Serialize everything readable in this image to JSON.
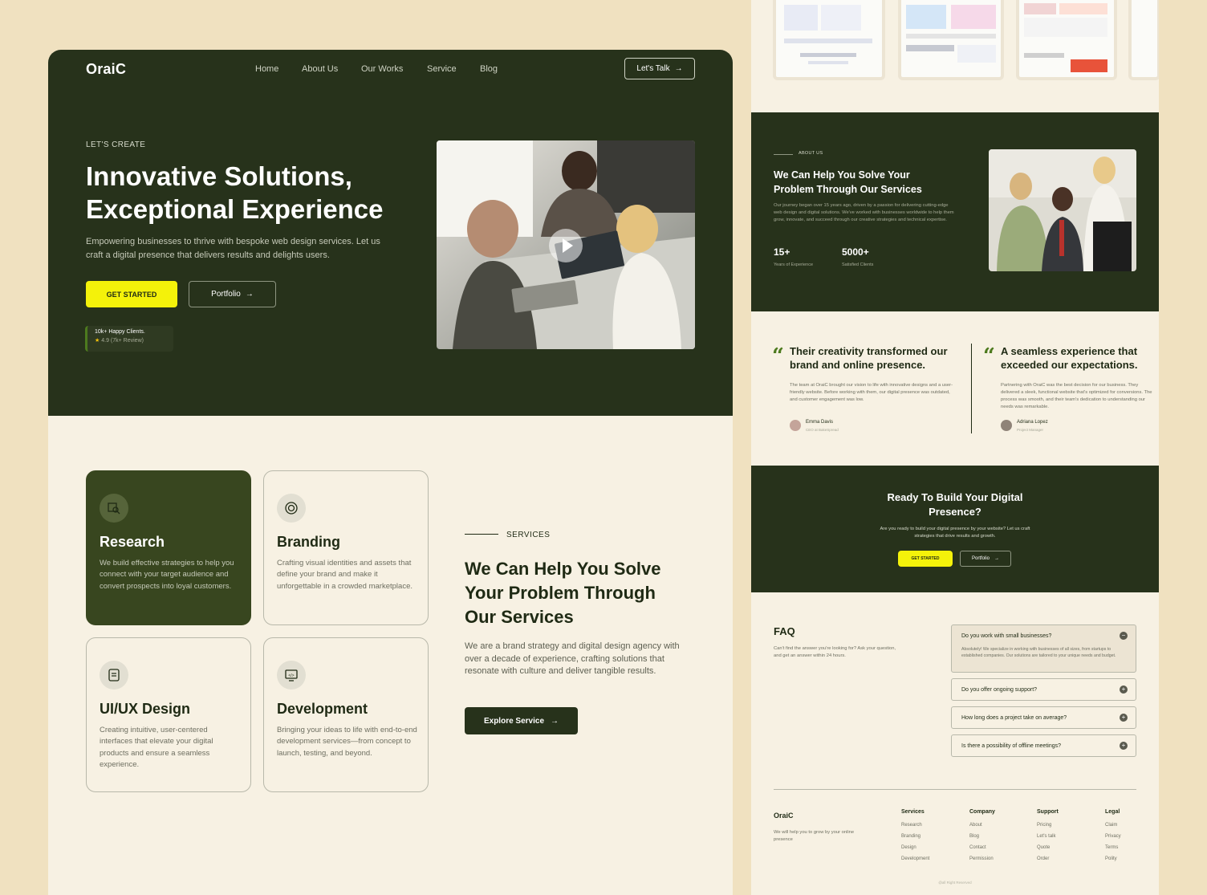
{
  "hero": {
    "logo": "OraiC",
    "nav": [
      "Home",
      "About Us",
      "Our Works",
      "Service",
      "Blog"
    ],
    "cta_talk": "Let's Talk",
    "eyebrow": "LET'S CREATE",
    "title_line1": "Innovative Solutions,",
    "title_line2": "Exceptional Experience",
    "description": "Empowering businesses to thrive with bespoke web design services. Let us craft a digital presence that delivers results and delights users.",
    "get_started": "GET STARTED",
    "portfolio": "Portfolio",
    "happy_clients": "10k+ Happy Clients.",
    "rating": "4.9 (7k+ Review)"
  },
  "services": {
    "cards": [
      {
        "title": "Research",
        "text": "We build effective strategies to help you connect with your target audience and convert prospects into loyal customers.",
        "icon": "research-icon"
      },
      {
        "title": "Branding",
        "text": "Crafting visual identities and assets that define your brand and make it unforgettable in a crowded marketplace.",
        "icon": "branding-icon"
      },
      {
        "title": "UI/UX Design",
        "text": "Creating intuitive, user-centered interfaces that elevate your digital products and ensure a seamless experience.",
        "icon": "uiux-icon"
      },
      {
        "title": "Development",
        "text": "Bringing your ideas to life with end-to-end development services—from concept to launch, testing, and beyond.",
        "icon": "development-icon"
      }
    ],
    "eyebrow": "SERVICES",
    "title": "We Can Help You Solve Your Problem Through Our Services",
    "description": "We are a brand strategy and digital design agency with over a decade of experience, crafting solutions that resonate with culture and deliver tangible results.",
    "explore": "Explore Service"
  },
  "about": {
    "eyebrow": "ABOUT US",
    "title": "We Can Help You Solve Your Problem Through Our Services",
    "text": "Our journey began over 15 years ago, driven by a passion for delivering cutting-edge web design and digital solutions. We've worked with businesses worldwide to help them grow, innovate, and succeed through our creative strategies and technical expertise.",
    "stat1_value": "15+",
    "stat1_label": "Years of Experience",
    "stat2_value": "5000+",
    "stat2_label": "Satisfied Clients"
  },
  "testimonials": [
    {
      "quote": "Their creativity transformed our brand and online presence.",
      "text": "The team at OraiC brought our vision to life with innovative designs and a user-friendly website. Before working with them, our digital presence was outdated, and customer engagement was low.",
      "name": "Emma Davis",
      "role": "CEO at BakeSpread"
    },
    {
      "quote": "A seamless experience that exceeded our expectations.",
      "text": "Partnering with OraiC was the best decision for our business. They delivered a sleek, functional website that's optimized for conversions. The process was smooth, and their team's dedication to understanding our needs was remarkable.",
      "name": "Adriana Lopez",
      "role": "Project Manager"
    }
  ],
  "cta": {
    "title": "Ready To Build Your Digital Presence?",
    "text": "Are you ready to build your digital presence by your website? Let us craft strategies that drive results and growth.",
    "get_started": "GET STARTED",
    "portfolio": "Portfolio"
  },
  "faq": {
    "title": "FAQ",
    "subtitle": "Can't find the answer you're looking for? Ask your question, and get an answer within 24 hours.",
    "items": [
      {
        "q": "Do you work with small businesses?",
        "a": "Absolutely! We specialize in working with businesses of all sizes, from startups to established companies. Our solutions are tailored to your unique needs and budget."
      },
      {
        "q": "Do you offer ongoing support?"
      },
      {
        "q": "How long does a project take on average?"
      },
      {
        "q": "Is there a possibility of offline meetings?"
      }
    ]
  },
  "footer": {
    "logo": "OraiC",
    "tagline": "We will help you to grow by your online presence",
    "columns": [
      {
        "title": "Services",
        "items": [
          "Research",
          "Branding",
          "Design",
          "Development"
        ]
      },
      {
        "title": "Company",
        "items": [
          "About",
          "Blog",
          "Contact",
          "Permission"
        ]
      },
      {
        "title": "Support",
        "items": [
          "Pricing",
          "Let's talk",
          "Quote",
          "Order"
        ]
      },
      {
        "title": "Legal",
        "items": [
          "Claim",
          "Privacy",
          "Terms",
          "Polity"
        ]
      }
    ],
    "copyright": "@all Right Reserved"
  },
  "colors": {
    "primary": "#27321b",
    "accent": "#f4f20a",
    "background": "#f0e1c0",
    "cream": "#f7f1e3"
  }
}
